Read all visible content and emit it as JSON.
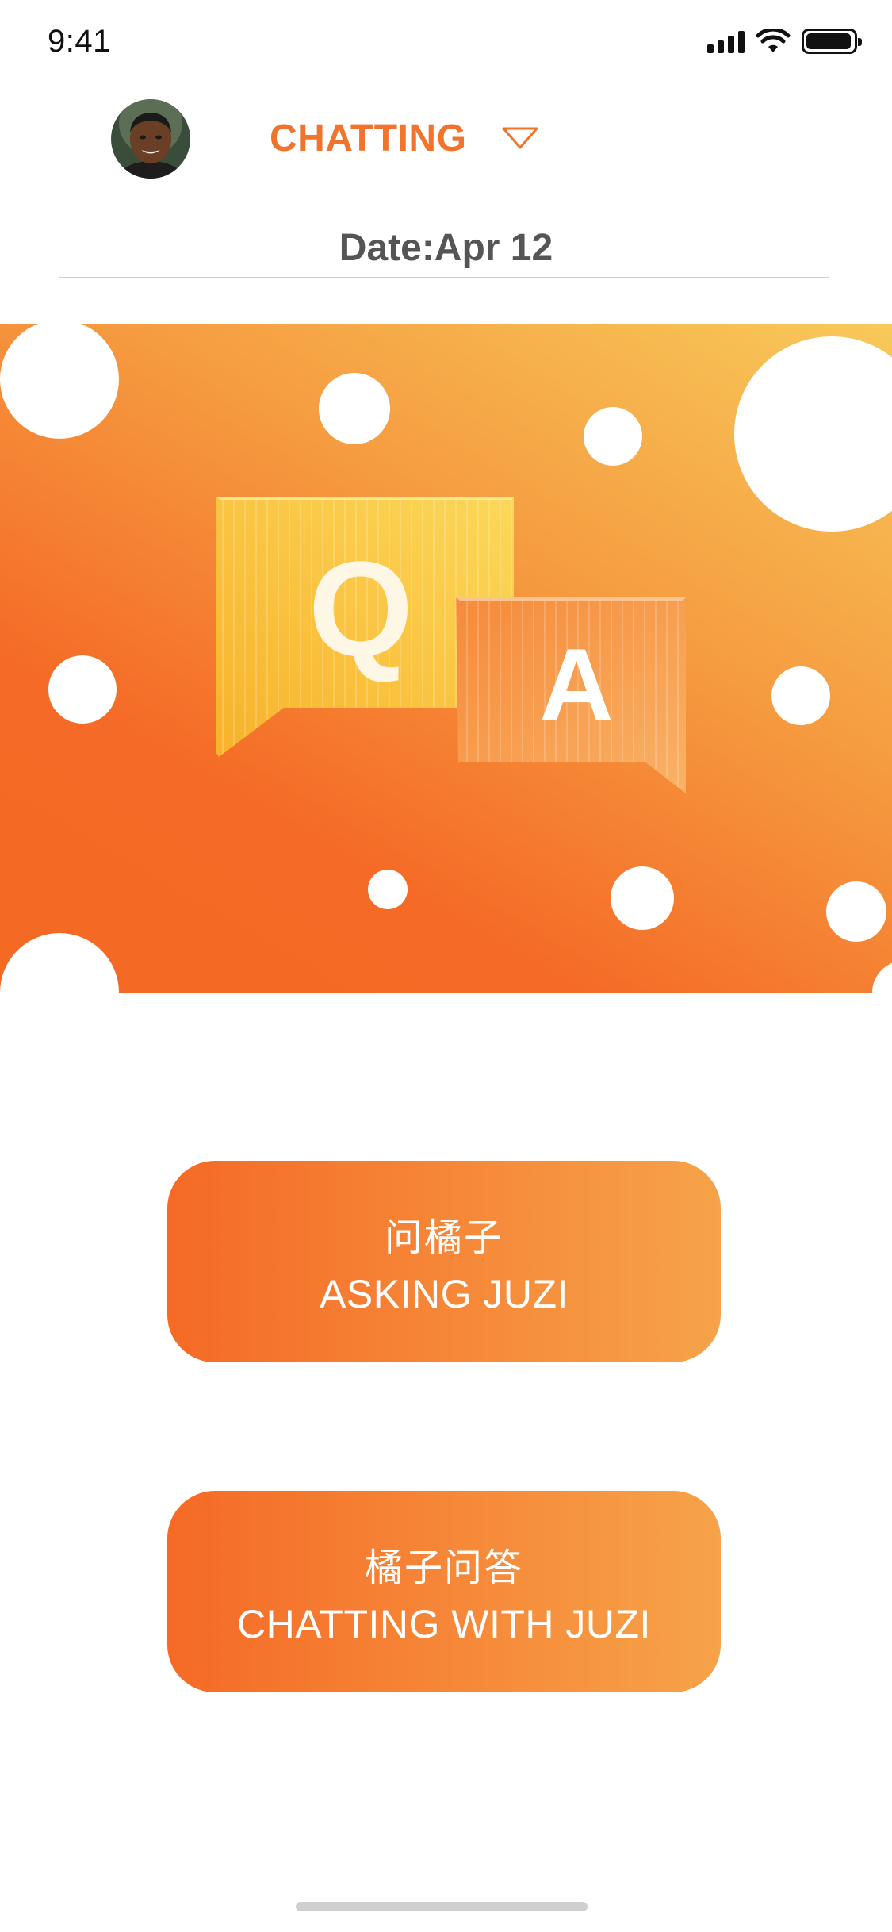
{
  "status_bar": {
    "time": "9:41"
  },
  "header": {
    "title": "CHATTING",
    "date": "Date:Apr 12"
  },
  "banner": {
    "q_letter": "Q",
    "a_letter": "A"
  },
  "buttons": [
    {
      "cn": "问橘子",
      "en": "ASKING JUZI"
    },
    {
      "cn": "橘子问答",
      "en": "CHATTING WITH JUZI"
    }
  ],
  "colors": {
    "accent": "#f2742c",
    "gradient_start": "#f56a26",
    "gradient_end": "#f6a349",
    "banner_light": "#f8c95a"
  },
  "icons": [
    "signal-icon",
    "wifi-icon",
    "battery-icon",
    "chevron-down-icon",
    "avatar"
  ]
}
